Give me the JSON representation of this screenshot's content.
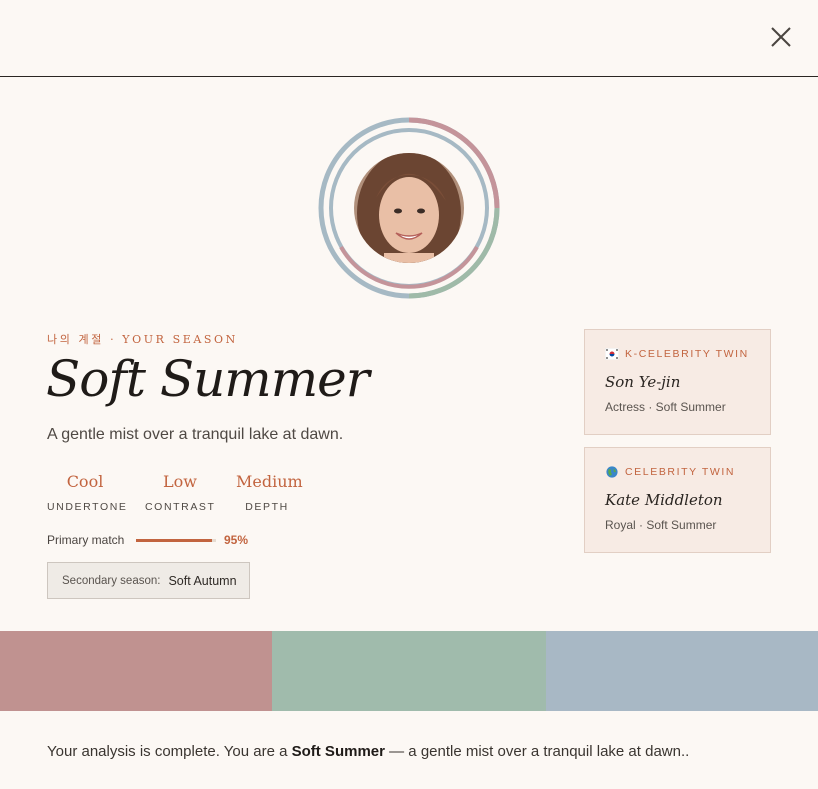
{
  "header": {
    "close_icon": "close-icon"
  },
  "avatar": {
    "alt": "Profile portrait",
    "ring_colors": [
      "#c4949a",
      "#a6b9c4",
      "#9fbaa8"
    ]
  },
  "season": {
    "eyebrow": "나의 계절 · YOUR SEASON",
    "name": "Soft Summer",
    "description": "A gentle mist over a tranquil lake at dawn."
  },
  "stats": [
    {
      "value": "Cool",
      "label": "UNDERTONE"
    },
    {
      "value": "Low",
      "label": "CONTRAST"
    },
    {
      "value": "Medium",
      "label": "DEPTH"
    }
  ],
  "match": {
    "label": "Primary match",
    "percent": 95,
    "percent_text": "95%"
  },
  "secondary": {
    "label": "Secondary season:",
    "value": "Soft Autumn"
  },
  "twins": [
    {
      "icon": "korea-flag-icon",
      "heading": "K-CELEBRITY TWIN",
      "name": "Son Ye-jin",
      "role": "Actress · Soft Summer"
    },
    {
      "icon": "globe-icon",
      "heading": "CELEBRITY TWIN",
      "name": "Kate Middleton",
      "role": "Royal · Soft Summer"
    }
  ],
  "palette": [
    "#c09290",
    "#a0bbac",
    "#a8b8c5"
  ],
  "summary": {
    "prefix": "Your analysis is complete. You are a ",
    "season": "Soft Summer",
    "suffix": " — a gentle mist over a tranquil lake at dawn.."
  },
  "colors": {
    "accent": "#c2643f",
    "background": "#fcf8f4"
  }
}
